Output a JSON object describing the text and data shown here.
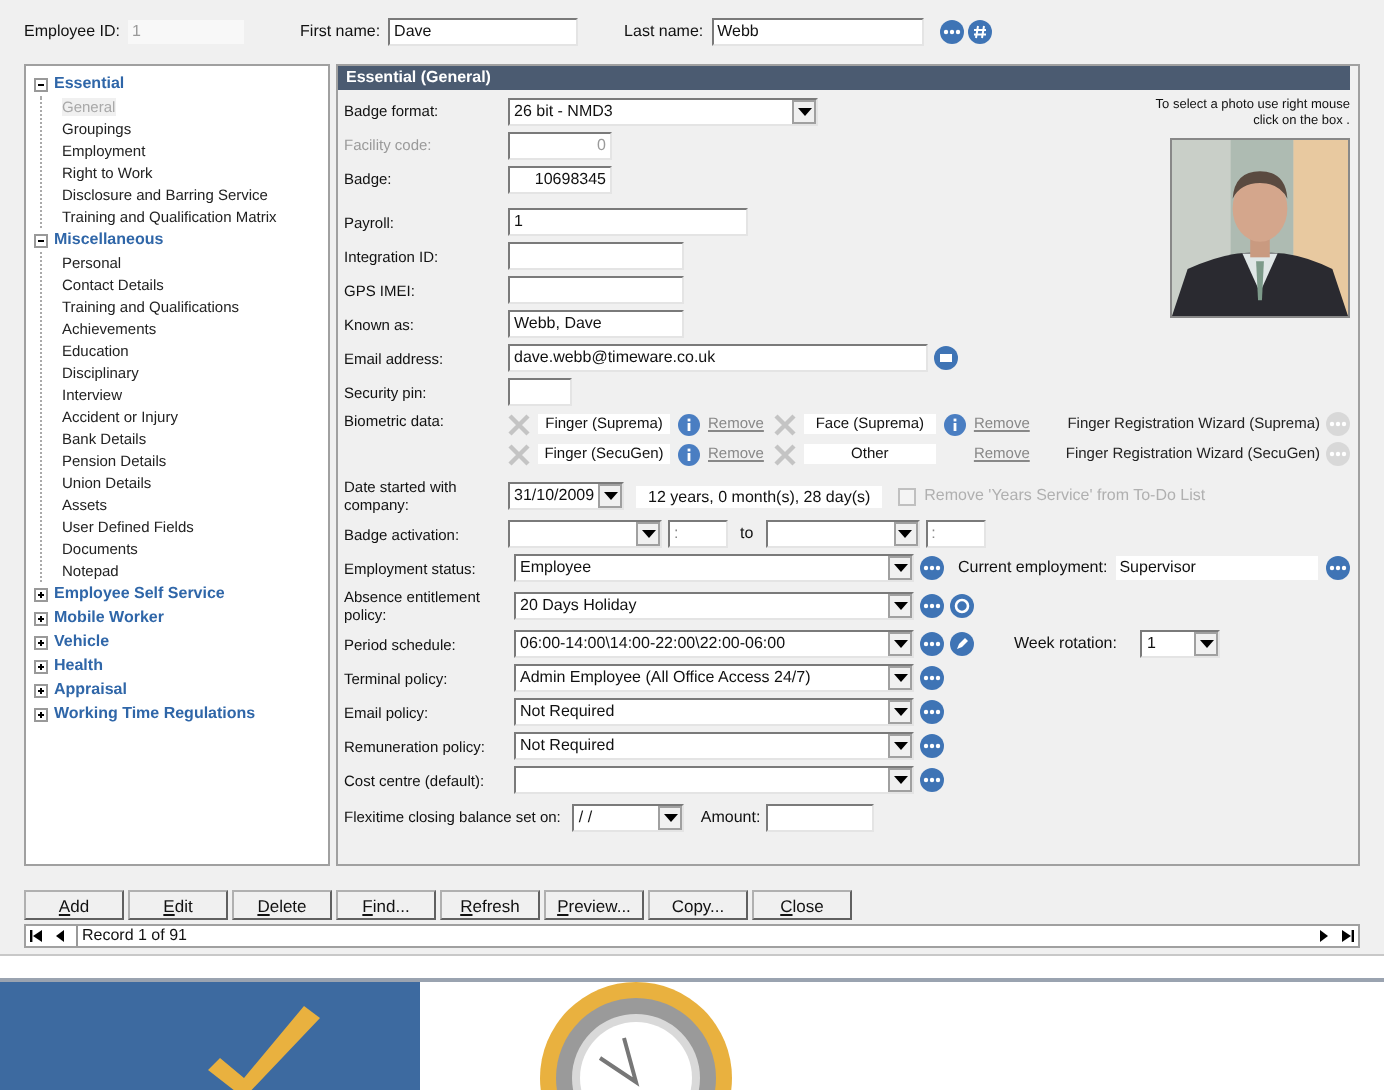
{
  "header": {
    "employee_id_label": "Employee ID:",
    "employee_id": "1",
    "first_name_label": "First name:",
    "first_name": "Dave",
    "last_name_label": "Last name:",
    "last_name": "Webb"
  },
  "tree": [
    {
      "label": "Essential",
      "expanded": true,
      "children": [
        {
          "label": "General",
          "selected": true
        },
        {
          "label": "Groupings",
          "selected": false
        },
        {
          "label": "Employment",
          "selected": false
        },
        {
          "label": "Right to Work",
          "selected": false
        },
        {
          "label": "Disclosure and Barring Service",
          "selected": false
        },
        {
          "label": "Training and Qualification Matrix",
          "selected": false
        }
      ]
    },
    {
      "label": "Miscellaneous",
      "expanded": true,
      "children": [
        {
          "label": "Personal",
          "selected": false
        },
        {
          "label": "Contact Details",
          "selected": false
        },
        {
          "label": "Training and Qualifications",
          "selected": false
        },
        {
          "label": "Achievements",
          "selected": false
        },
        {
          "label": "Education",
          "selected": false
        },
        {
          "label": "Disciplinary",
          "selected": false
        },
        {
          "label": "Interview",
          "selected": false
        },
        {
          "label": "Accident or Injury",
          "selected": false
        },
        {
          "label": "Bank Details",
          "selected": false
        },
        {
          "label": "Pension Details",
          "selected": false
        },
        {
          "label": "Union Details",
          "selected": false
        },
        {
          "label": "Assets",
          "selected": false
        },
        {
          "label": "User Defined Fields",
          "selected": false
        },
        {
          "label": "Documents",
          "selected": false
        },
        {
          "label": "Notepad",
          "selected": false
        }
      ]
    },
    {
      "label": "Employee Self Service",
      "expanded": false
    },
    {
      "label": "Mobile Worker",
      "expanded": false
    },
    {
      "label": "Vehicle",
      "expanded": false
    },
    {
      "label": "Health",
      "expanded": false
    },
    {
      "label": "Appraisal",
      "expanded": false
    },
    {
      "label": "Working Time Regulations",
      "expanded": false
    }
  ],
  "section_title": "Essential (General)",
  "photo_hint": "To select a photo use right mouse click on the box .",
  "badge_fields": [
    {
      "label": "Badge format:",
      "value": "26 bit - NMD3",
      "kind": "select",
      "disabled": false
    },
    {
      "label": "Facility code:",
      "value": "0",
      "kind": "number",
      "disabled": true
    },
    {
      "label": "Badge:",
      "value": "10698345",
      "kind": "number",
      "disabled": false
    }
  ],
  "id_fields": [
    {
      "label": "Payroll:",
      "value": "1",
      "kind": "wide"
    },
    {
      "label": "Integration ID:",
      "kind": "text"
    },
    {
      "label": "GPS IMEI:",
      "kind": "text"
    },
    {
      "label": "Known as:",
      "value": "Webb, Dave",
      "kind": "text"
    },
    {
      "label": "Email address:",
      "value": "dave.webb@timeware.co.uk",
      "kind": "email"
    },
    {
      "label": "Security pin:",
      "kind": "pin"
    }
  ],
  "biometrics": {
    "label": "Biometric data:",
    "items": [
      {
        "name": "Finger (Suprema)",
        "info": true,
        "remove": "Remove"
      },
      {
        "name": "Face (Suprema)",
        "info": true,
        "remove": "Remove"
      },
      {
        "name": "Finger (SecuGen)",
        "info": true,
        "remove": "Remove"
      },
      {
        "name": "Other",
        "info": false,
        "remove": "Remove"
      }
    ],
    "wizards": [
      {
        "label": "Finger Registration Wizard (Suprema)",
        "disabled": true
      },
      {
        "label": "Finger Registration Wizard (SecuGen)",
        "disabled": true
      }
    ]
  },
  "date_started": {
    "label": "Date started with company:",
    "value": "31/10/2009",
    "duration": "12 years, 0 month(s), 28 day(s)",
    "todo_label": "Remove 'Years Service' from To-Do List",
    "todo_checked": false,
    "todo_disabled": true
  },
  "badge_activation": {
    "label": "Badge activation:",
    "from_time": ":",
    "to": "to",
    "to_time": ":"
  },
  "policies": [
    {
      "label": "Employment status:",
      "value": "Employee",
      "kind": "employment"
    },
    {
      "label": "Absence entitlement policy:",
      "value": "20 Days Holiday",
      "kind": "absence"
    },
    {
      "label": "Period schedule:",
      "value": "06:00-14:00\\14:00-22:00\\22:00-06:00",
      "kind": "schedule"
    },
    {
      "label": "Terminal policy:",
      "value": "Admin Employee (All Office Access 24/7)",
      "kind": "plain"
    },
    {
      "label": "Email policy:",
      "value": "Not Required",
      "kind": "plain"
    },
    {
      "label": "Remuneration policy:",
      "value": "Not Required",
      "kind": "plain"
    },
    {
      "label": "Cost centre (default):",
      "kind": "plain"
    }
  ],
  "current_employment": {
    "label": "Current employment:",
    "value": "Supervisor"
  },
  "week_rotation": {
    "label": "Week rotation:",
    "value": "1"
  },
  "flexitime": {
    "label": "Flexitime closing balance set on:",
    "value": " /  /",
    "amount_label": "Amount:"
  },
  "buttons": [
    {
      "label": "Add",
      "mnemonic": true
    },
    {
      "label": "Edit",
      "mnemonic": true
    },
    {
      "label": "Delete",
      "mnemonic": true
    },
    {
      "label": "Find...",
      "mnemonic": true
    },
    {
      "label": "Refresh",
      "mnemonic": true
    },
    {
      "label": "Preview...",
      "mnemonic": true
    },
    {
      "label": "Copy...",
      "mnemonic": false
    },
    {
      "label": "Close",
      "mnemonic": true
    }
  ],
  "record_nav": {
    "text": "Record 1 of 91"
  }
}
